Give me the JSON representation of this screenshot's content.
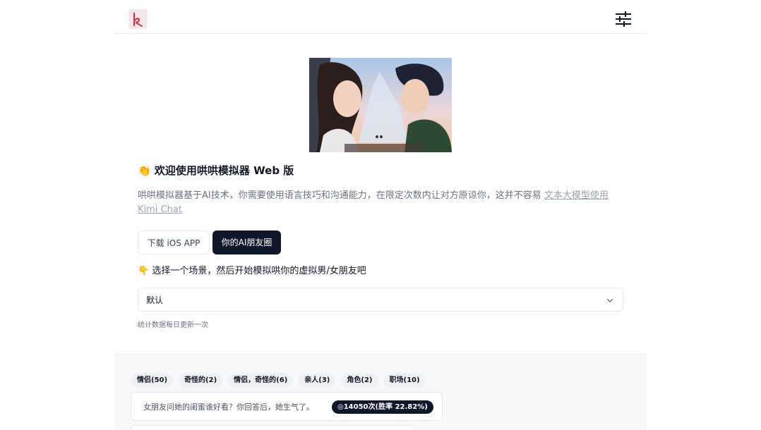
{
  "header": {
    "logo_icon": "hong-logo-icon",
    "settings_icon": "sliders-icon"
  },
  "hero": {
    "image": "anime-couple-image"
  },
  "welcome": {
    "emoji": "👏",
    "title": "欢迎使用哄哄模拟器 Web 版"
  },
  "description": {
    "text": "哄哄模拟器基于AI技术，你需要使用语言技巧和沟通能力，在限定次数内让对方原谅你，这并不容易 ",
    "link": "文本大模型使用 Kimi Chat"
  },
  "buttons": {
    "ios": "下载 iOS APP",
    "circle": "你的AI朋友圈"
  },
  "choose": {
    "emoji": "👇",
    "text": "选择一个场景，然后开始模拟哄你的虚拟男/女朋友吧"
  },
  "scenario_select": {
    "value": "默认",
    "icon": "chevron-down-icon"
  },
  "stats_note": "统计数据每日更新一次",
  "tags": [
    "情侣(50)",
    "奇怪的(2)",
    "情侣，奇怪的(6)",
    "亲人(3)",
    "角色(2)",
    "职场(10)"
  ],
  "scenarios": [
    {
      "question": "女朋友问她的闺蜜谁好看？你回答后，她生气了。",
      "stats": "◎14050次(胜率 22.82%)"
    }
  ]
}
